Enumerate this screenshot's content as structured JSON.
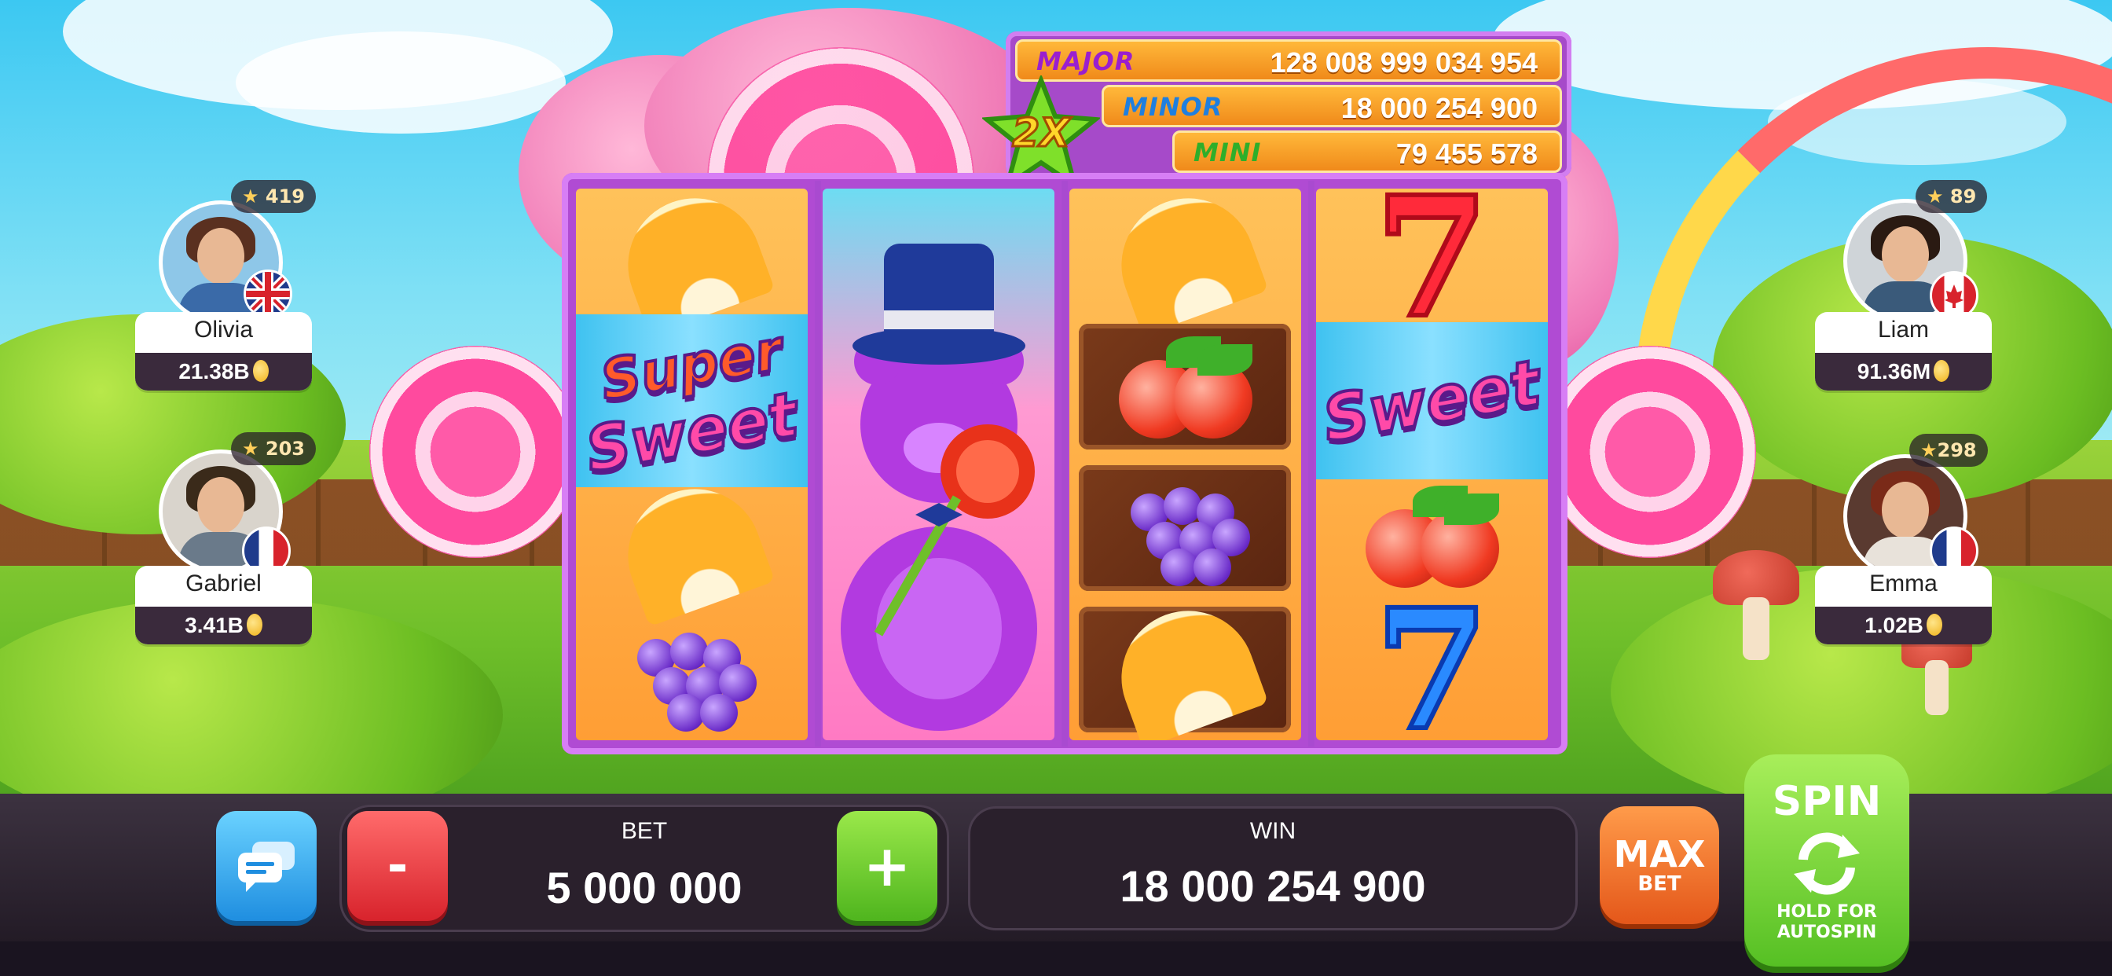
{
  "jackpots": [
    {
      "name": "MAJOR",
      "value": "128 008 999 034 954",
      "color": "#9a1fcf"
    },
    {
      "name": "MINOR",
      "value": "18 000 254 900",
      "color": "#1f7fdf"
    },
    {
      "name": "MINI",
      "value": "79 455 578",
      "color": "#2fae2a"
    }
  ],
  "multiplier_badge": "2X",
  "reels": [
    {
      "symbols": [
        "orange-icon",
        "super-sweet-icon",
        "orange-icon",
        "grapes-icon"
      ]
    },
    {
      "symbols": [
        "gummy-bear-icon"
      ]
    },
    {
      "symbols": [
        "orange-icon",
        "cherry-icon",
        "grapes-icon",
        "orange-icon"
      ]
    },
    {
      "symbols": [
        "red-seven-icon",
        "sweet-icon",
        "cherry-icon",
        "blue-seven-icon"
      ]
    }
  ],
  "symbol_text": {
    "super": "Super",
    "sweet": "Sweet"
  },
  "players": {
    "olivia": {
      "name": "Olivia",
      "balance": "21.38B",
      "stars": "419",
      "flag": "uk-flag-icon"
    },
    "gabriel": {
      "name": "Gabriel",
      "balance": "3.41B",
      "stars": "203",
      "flag": "france-flag-icon"
    },
    "liam": {
      "name": "Liam",
      "balance": "91.36M",
      "stars": "89",
      "flag": "canada-flag-icon"
    },
    "emma": {
      "name": "Emma",
      "balance": "1.02B",
      "stars": "298",
      "flag": "france-flag-icon"
    }
  },
  "controls": {
    "minus_label": "-",
    "plus_label": "+",
    "bet_label": "BET",
    "bet_value": "5 000 000",
    "win_label": "WIN",
    "win_value": "18 000 254 900",
    "maxbet_line1": "MAX",
    "maxbet_line2": "BET",
    "spin_label": "SPIN",
    "spin_sub1": "HOLD FOR",
    "spin_sub2": "AUTOSPIN"
  }
}
